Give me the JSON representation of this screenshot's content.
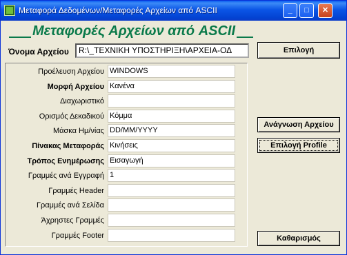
{
  "window": {
    "title": "Μεταφορά Δεδομένων/Μεταφορές Αρχείων από ASCII",
    "min_glyph": "_",
    "max_glyph": "□",
    "close_glyph": "✕"
  },
  "banner": {
    "title": "Μεταφορές Αρχείων από ASCII"
  },
  "file": {
    "label": "Όνομα Αρχείου",
    "value": "R:\\_ΤΕΧΝΙΚΗ ΥΠΟΣΤΗΡΙΞΗ\\ΑΡΧΕΙΑ-ΟΔ"
  },
  "buttons": {
    "select": "Επιλογή",
    "read_file": "Ανάγνωση Αρχείου",
    "select_profile": "Επιλογή Profile",
    "clear": "Καθαρισμός"
  },
  "fields": [
    {
      "label": "Προέλευση Αρχείου",
      "value": "WINDOWS",
      "bold": false
    },
    {
      "label": "Μορφή Αρχείου",
      "value": "Κανένα",
      "bold": true
    },
    {
      "label": "Διαχωριστικό",
      "value": "",
      "bold": false
    },
    {
      "label": "Ορισμός Δεκαδικού",
      "value": "Κόμμα",
      "bold": false
    },
    {
      "label": "Μάσκα Ημ/νίας",
      "value": "DD/MM/YYYY",
      "bold": false
    },
    {
      "label": "Πίνακας Μεταφοράς",
      "value": "Κινήσεις",
      "bold": true
    },
    {
      "label": "Τρόπος Ενημέρωσης",
      "value": "Εισαγωγή",
      "bold": true
    },
    {
      "label": "Γραμμές ανά Εγγραφή",
      "value": "1",
      "bold": false
    },
    {
      "label": "Γραμμές Header",
      "value": "",
      "bold": false
    },
    {
      "label": "Γραμμές ανά Σελίδα",
      "value": "",
      "bold": false
    },
    {
      "label": "Άχρηστες Γραμμές",
      "value": "",
      "bold": false
    },
    {
      "label": "Γραμμές Footer",
      "value": "",
      "bold": false
    }
  ]
}
